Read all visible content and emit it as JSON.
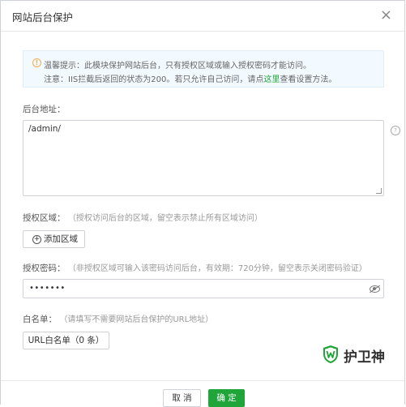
{
  "dialog": {
    "title": "网站后台保护",
    "close_glyph": "×"
  },
  "notice": {
    "icon": "warning-circle-icon",
    "line1": "温馨提示：此模块保护网站后台，只有授权区域或输入授权密码才能访问。",
    "line2_prefix": "注意：IIS拦截后返回的状态为200。若只允许自己访问，请点",
    "line2_link": "这里",
    "line2_suffix": "查看设置方法。"
  },
  "admin_url": {
    "label": "后台地址：",
    "value": "/admin/",
    "help_glyph": "?"
  },
  "auth_area": {
    "label": "授权区域：",
    "hint": "（授权访问后台的区域，留空表示禁止所有区域访问）",
    "add_button": "添加区域"
  },
  "auth_password": {
    "label": "授权密码：",
    "hint": "（非授权区域可输入该密码访问后台，有效期：720分钟，留空表示关闭密码验证）",
    "value": "•••••••"
  },
  "whitelist": {
    "label": "白名单：",
    "hint": "（请填写不需要网站后台保护的URL地址）",
    "button": "URL白名单（0 条）"
  },
  "brand": {
    "name": "护卫神",
    "color": "#20a53a"
  },
  "footer": {
    "cancel": "取 消",
    "confirm": "确 定"
  }
}
